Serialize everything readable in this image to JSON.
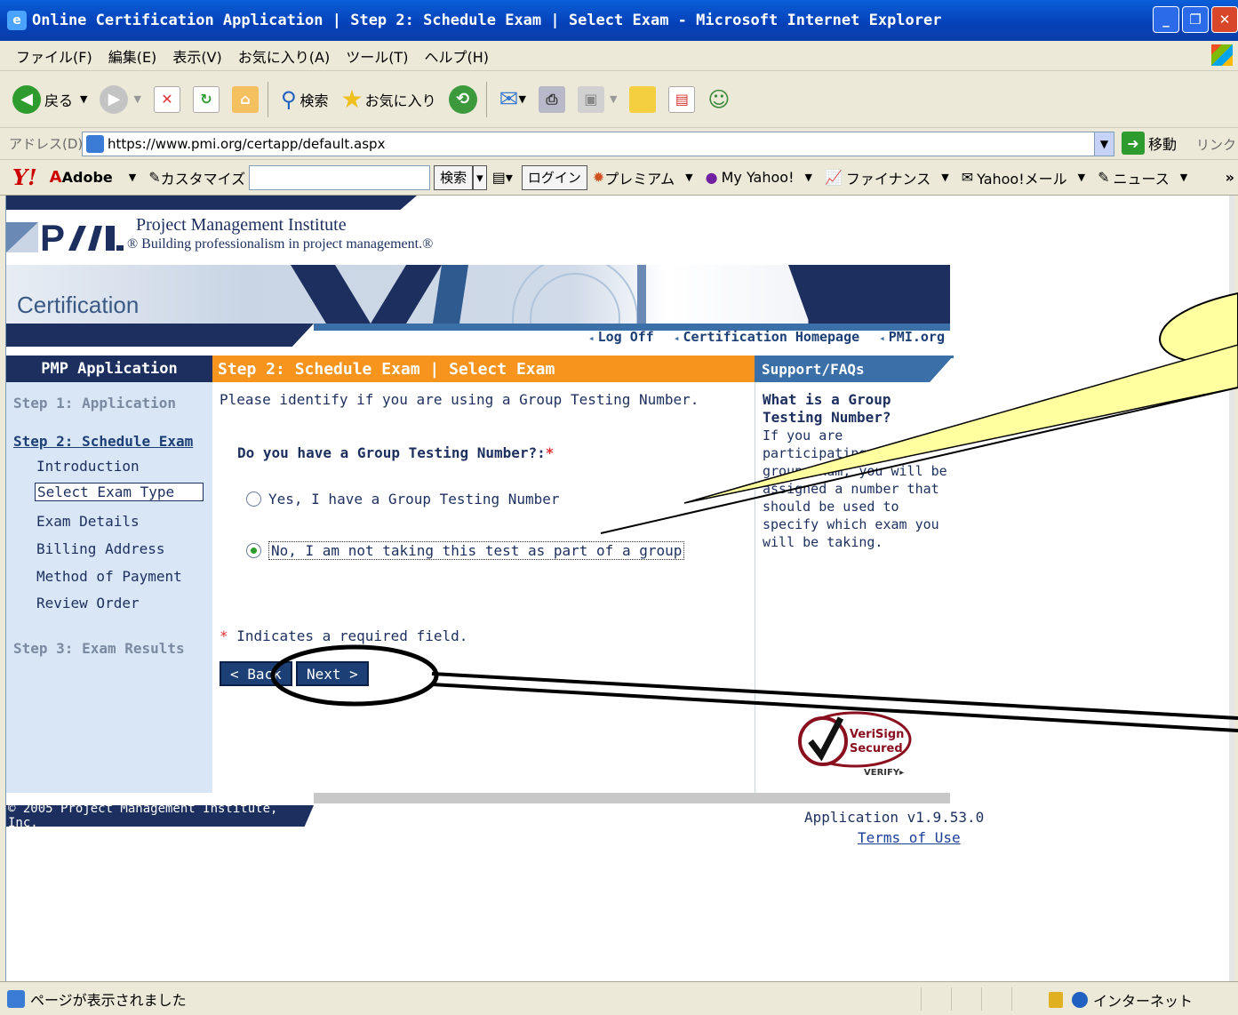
{
  "window": {
    "title": "Online Certification Application | Step 2: Schedule Exam | Select Exam - Microsoft Internet Explorer",
    "icon": "ie-icon"
  },
  "menu": [
    "ファイル(F)",
    "編集(E)",
    "表示(V)",
    "お気に入り(A)",
    "ツール(T)",
    "ヘルプ(H)"
  ],
  "toolbar": {
    "back_label": "戻る",
    "search_label": "検索",
    "favorites_label": "お気に入り"
  },
  "address": {
    "label": "アドレス(D)",
    "url": "https://www.pmi.org/certapp/default.aspx",
    "go_label": "移動",
    "links_label": "リンク"
  },
  "yahoo": {
    "adobe": "Adobe",
    "customize": "カスタマイズ",
    "search_btn": "検索",
    "login": "ログイン",
    "premium": "プレミアム",
    "myyahoo": "My Yahoo!",
    "finance": "ファイナンス",
    "mail": "Yahoo!メール",
    "news": "ニュース"
  },
  "pmi": {
    "name": "Project Management Institute",
    "tagline": "® Building professionalism in project management.®",
    "section": "Certification",
    "nav_links": [
      "Log Off",
      "Certification Homepage",
      "PMI.org"
    ]
  },
  "leftnav": {
    "title": "PMP Application",
    "step1": "Step 1: Application",
    "step2": "Step 2: Schedule Exam",
    "substeps": [
      "Introduction",
      "Select Exam Type",
      "Exam Details",
      "Billing Address",
      "Method of Payment",
      "Review Order"
    ],
    "step3": "Step 3: Exam Results"
  },
  "main": {
    "heading": "Step 2: Schedule Exam | Select Exam",
    "intro": "Please identify if you are using a Group Testing Number.",
    "question": "Do you have a Group Testing Number?:",
    "required_mark": "*",
    "option_yes": "Yes, I have a Group Testing Number",
    "option_no": "No, I am not taking this test as part of a group",
    "required_note": "Indicates a required field.",
    "back_button": "< Back",
    "next_button": "Next >"
  },
  "support": {
    "heading": "Support/FAQs",
    "question": "What is a Group Testing Number?",
    "answer": "If you are participating in a group exam, you will be assigned a number that should be used to specify which exam you will be taking."
  },
  "verisign": {
    "line1": "VeriSign",
    "line2": "Secured",
    "line3": "VERIFY▸"
  },
  "footer": {
    "copyright": "© 2005 Project Management Institute, Inc.",
    "version": "Application v1.9.53.0",
    "terms": "Terms of Use"
  },
  "status": {
    "text": "ページが表示されました",
    "zone": "インターネット"
  }
}
